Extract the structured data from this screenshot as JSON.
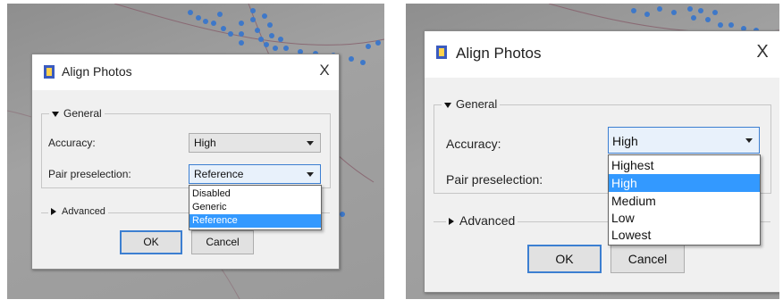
{
  "left": {
    "dialog": {
      "title": "Align Photos",
      "close_glyph": "X",
      "general_label": "General",
      "accuracy_label": "Accuracy:",
      "accuracy_value": "High",
      "pair_label": "Pair preselection:",
      "pair_value": "Reference",
      "pair_options": [
        "Disabled",
        "Generic",
        "Reference"
      ],
      "pair_selected": "Reference",
      "advanced_label": "Advanced",
      "ok_label": "OK",
      "cancel_label": "Cancel"
    }
  },
  "right": {
    "dialog": {
      "title": "Align Photos",
      "close_glyph": "X",
      "general_label": "General",
      "accuracy_label": "Accuracy:",
      "accuracy_value": "High",
      "accuracy_options": [
        "Highest",
        "High",
        "Medium",
        "Low",
        "Lowest"
      ],
      "accuracy_selected": "High",
      "pair_label": "Pair preselection:",
      "advanced_label": "Advanced",
      "ok_label": "OK",
      "cancel_label": "Cancel"
    }
  },
  "colors": {
    "selection": "#3399ff",
    "focus_border": "#3c7fd1",
    "backdrop": "#9a9a9a",
    "point_cloud": "#3e78c9"
  },
  "icons": {
    "app_icon": "photo-stack-icon",
    "close_icon": "close-x-icon",
    "expand_icon": "triangle-down-icon",
    "collapse_icon": "triangle-right-icon",
    "dropdown_icon": "chevron-down-icon"
  }
}
